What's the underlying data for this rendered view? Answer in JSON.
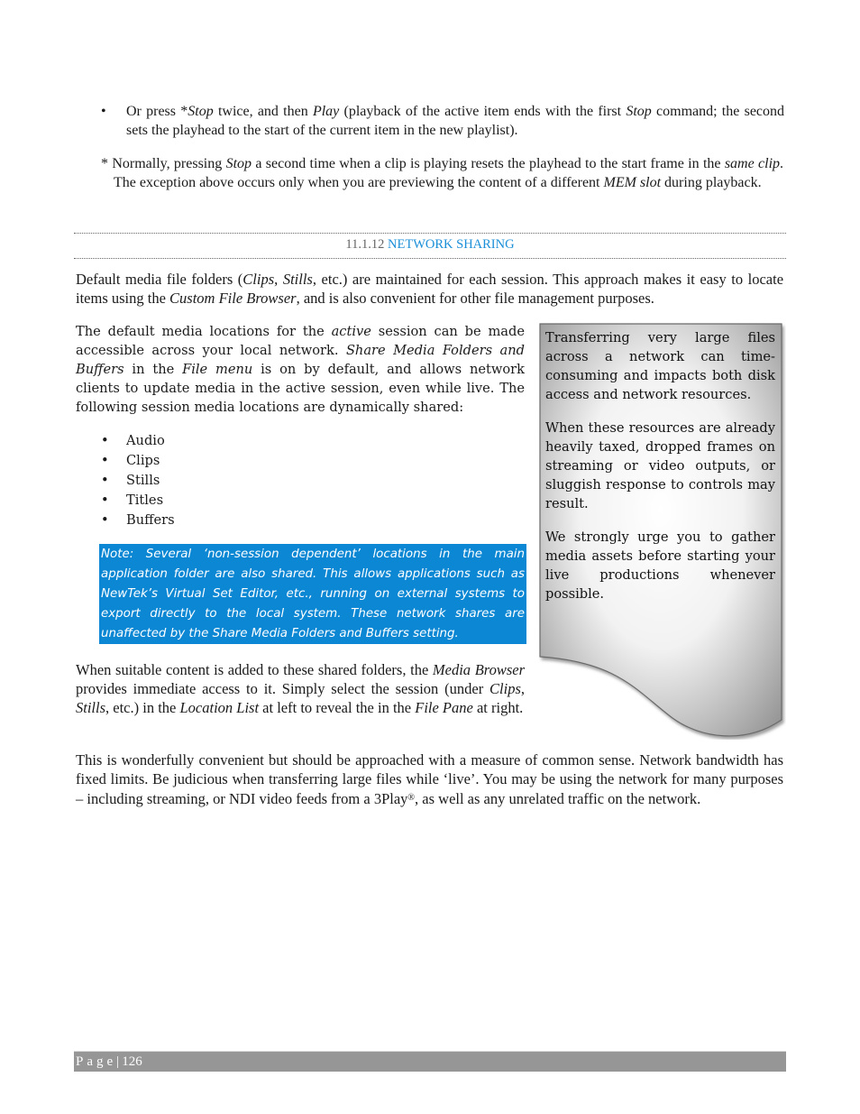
{
  "bullet_stop": {
    "parts": [
      "Or press *",
      "Stop",
      " twice, and then ",
      "Play",
      " (playback of the active item ends with the first ",
      "Stop",
      " command; the second sets the playhead to the start of the current item in the new playlist)."
    ]
  },
  "footnote": {
    "parts": [
      "* Normally, pressing ",
      "Stop",
      " a second time when a clip is playing resets the playhead to the start frame in the ",
      "same clip",
      ".  The exception above occurs only when you are previewing the content of a different ",
      "MEM slot",
      " during playback."
    ]
  },
  "section_heading": {
    "number": "11.1.12",
    "title": "NETWORK SHARING",
    "title_color": "#1b8fd8"
  },
  "para_default": {
    "parts": [
      "Default media file folders (",
      "Clips",
      ", ",
      "Stills",
      ", etc.) are maintained for each session.  This approach makes it easy to locate items using the ",
      "Custom File Browser",
      ", and is also convenient for other file management purposes."
    ]
  },
  "para_active": {
    "parts": [
      "The default media locations for the ",
      "active",
      " session can be made accessible across your local network.  ",
      "Share Media Folders and Buffers",
      " in the ",
      "File menu",
      " is on by default, and allows network clients to update media in the active session, even while live.  The following session media locations are dynamically shared:"
    ]
  },
  "shared_locations": [
    "Audio",
    "Clips",
    "Stills",
    "Titles",
    "Buffers"
  ],
  "note": {
    "text": "Note: Several ‘non-session dependent’ locations in the main application folder are also shared.  This allows applications such as NewTek’s Virtual Set Editor, etc., running on external systems to export directly to the local system.  These network shares are unaffected by the Share Media Folders and Buffers setting.",
    "background_color": "#0b87d4"
  },
  "sidebar": {
    "paragraphs": [
      "Transferring very large files across a network can time-consuming and impacts both disk access and network resources.",
      "When these resources are already heavily taxed, dropped frames on streaming or video outputs, or sluggish response to controls may result.",
      "We strongly urge you to gather media assets before starting your live productions whenever possible."
    ]
  },
  "para_media": {
    "parts": [
      "When suitable content is added to these shared folders, the ",
      "Media Browser",
      " provides immediate access to it.  Simply select the session (under ",
      "Clips",
      ", ",
      "Stills",
      ", etc.) in the ",
      "Location List",
      " at left to reveal the in the ",
      "File Pane",
      " at right."
    ]
  },
  "para_wonderful": {
    "text_before": "This is wonderfully convenient but should be approached with a measure of common sense.  Network bandwidth has fixed limits. Be judicious when transferring large files while ‘live’.  You may be using the network for many purposes – including streaming, or NDI video feeds from a 3Play",
    "reg": "®",
    "text_after": ", as well as any unrelated traffic on the network."
  },
  "footer": {
    "label": "Page",
    "separator": "|",
    "page_number": "126"
  }
}
